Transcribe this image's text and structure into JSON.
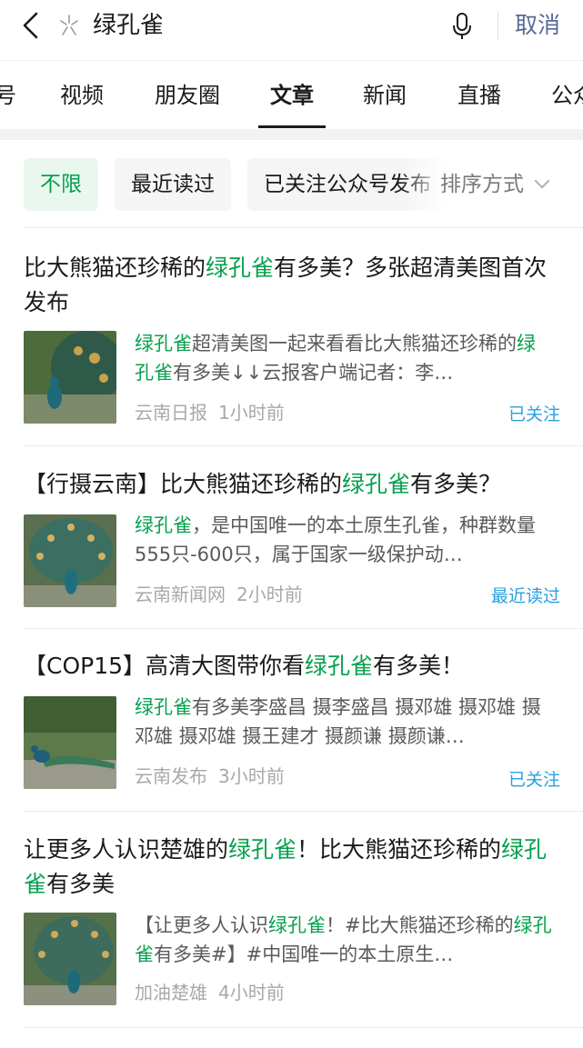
{
  "search": {
    "query": "绿孔雀",
    "cancel_label": "取消"
  },
  "tabs": [
    {
      "label": "号"
    },
    {
      "label": "视频"
    },
    {
      "label": "朋友圈"
    },
    {
      "label": "文章",
      "active": true
    },
    {
      "label": "新闻"
    },
    {
      "label": "直播"
    },
    {
      "label": "公众"
    }
  ],
  "filters": {
    "chips": [
      {
        "label": "不限",
        "selected": true
      },
      {
        "label": "最近读过"
      },
      {
        "label": "已关注公众号发布"
      }
    ],
    "sort_label": "排序方式"
  },
  "articles": [
    {
      "title_parts": [
        "比大熊猫还珍稀的",
        "绿孔雀",
        "有多美？多张超清美图首次发布"
      ],
      "snippet_parts": [
        "",
        "绿孔雀",
        "超清美图一起来看看比大熊猫还珍稀的",
        "绿孔雀",
        "有多美↓↓云报客户端记者：李…"
      ],
      "source": "云南日报",
      "time": "1小时前",
      "badge": "已关注"
    },
    {
      "title_parts": [
        "【行摄云南】比大熊猫还珍稀的",
        "绿孔雀",
        "有多美？"
      ],
      "snippet_parts": [
        "",
        "绿孔雀",
        "，是中国唯一的本土原生孔雀，种群数量555只-600只，属于国家一级保护动…"
      ],
      "source": "云南新闻网",
      "time": "2小时前",
      "badge": "最近读过"
    },
    {
      "title_parts": [
        "【COP15】高清大图带你看",
        "绿孔雀",
        "有多美！"
      ],
      "snippet_parts": [
        "",
        "绿孔雀",
        "有多美李盛昌 摄李盛昌 摄邓雄 摄邓雄 摄邓雄 摄邓雄 摄王建才 摄颜谦 摄颜谦…"
      ],
      "source": "云南发布",
      "time": "3小时前",
      "badge": "已关注"
    },
    {
      "title_parts": [
        "让更多人认识楚雄的",
        "绿孔雀",
        "！比大熊猫还珍稀的",
        "绿孔雀",
        "有多美"
      ],
      "snippet_parts": [
        "【让更多人认识",
        "绿孔雀",
        "！#比大熊猫还珍稀的",
        "绿孔雀",
        "有多美#】#中国唯一的本土原生…"
      ],
      "source": "加油楚雄",
      "time": "4小时前",
      "badge": ""
    }
  ],
  "colors": {
    "highlight": "#07a04e",
    "badge": "#2aa0e0",
    "cancel": "#576b95"
  }
}
